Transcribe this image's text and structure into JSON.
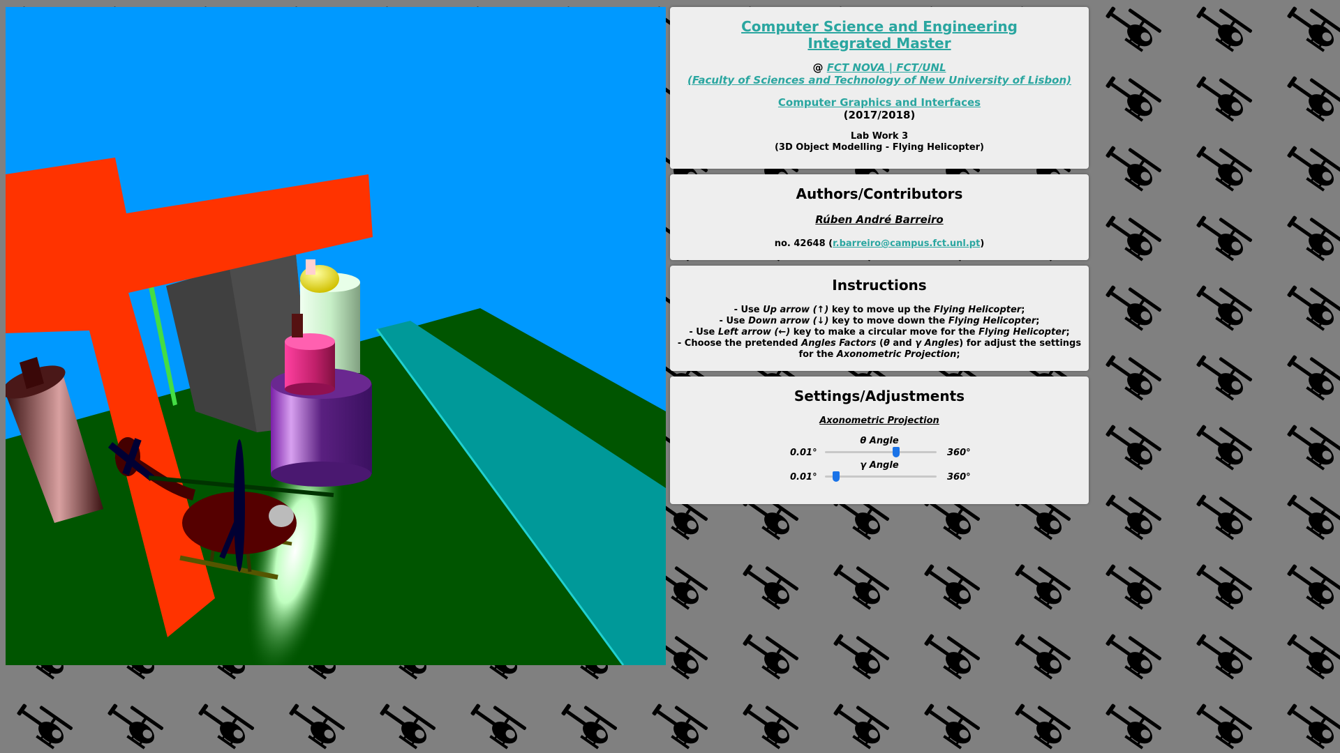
{
  "course": {
    "title_line1": "Computer Science and Engineering",
    "title_line2": "Integrated Master",
    "at_sign": "@",
    "institution_short": "FCT NOVA | FCT/UNL",
    "institution_full": "(Faculty of Sciences and Technology of New University of Lisbon)",
    "subject": "Computer Graphics and Interfaces",
    "year": "(2017/2018)",
    "lab_title": "Lab Work 3",
    "lab_subtitle": "(3D Object Modelling - Flying Helicopter)"
  },
  "authors": {
    "heading": "Authors/Contributors",
    "name": "Rúben André Barreiro",
    "number_prefix": "no. 42648 (",
    "email": "r.barreiro@campus.fct.unl.pt",
    "number_suffix": ")"
  },
  "instructions": {
    "heading": "Instructions",
    "items": [
      {
        "prefix": "- Use ",
        "key": "Up arrow (↑)",
        "middle": " key to move up the ",
        "target": "Flying Helicopter",
        "suffix": ";"
      },
      {
        "prefix": "- Use ",
        "key": "Down arrow (↓)",
        "middle": " key to move down the ",
        "target": "Flying Helicopter",
        "suffix": ";"
      },
      {
        "prefix": "- Use ",
        "key": "Left arrow (←)",
        "middle": " key to make a circular move for the ",
        "target": "Flying Helicopter",
        "suffix": ";"
      }
    ],
    "last_item": {
      "prefix": "- Choose the pretended ",
      "factors": "Angles Factors",
      "open": " (",
      "theta": "θ",
      "and": " and ",
      "gamma": "γ Angles",
      "middle": ") for adjust the settings",
      "line2_prefix": "for the ",
      "projection": "Axonometric Projection",
      "suffix": ";"
    }
  },
  "settings": {
    "heading": "Settings/Adjustments",
    "projection_label": "Axonometric Projection",
    "theta_slider": {
      "label": "θ Angle",
      "min_label": "0.01°",
      "max_label": "360°",
      "min": 0.01,
      "max": 360,
      "value": 230
    },
    "gamma_slider": {
      "label": "γ Angle",
      "min_label": "0.01°",
      "max_label": "360°",
      "min": 0.01,
      "max": 360,
      "value": 35
    }
  },
  "colors": {
    "background": "#808080",
    "panel": "#eeeeee",
    "link": "#2aa6a0",
    "sky": "#0099ff",
    "ground": "#005500",
    "runway": "#009999",
    "building_orange": "#ff3300",
    "helicopter_body": "#550000",
    "slider_thumb": "#1a73e8"
  }
}
